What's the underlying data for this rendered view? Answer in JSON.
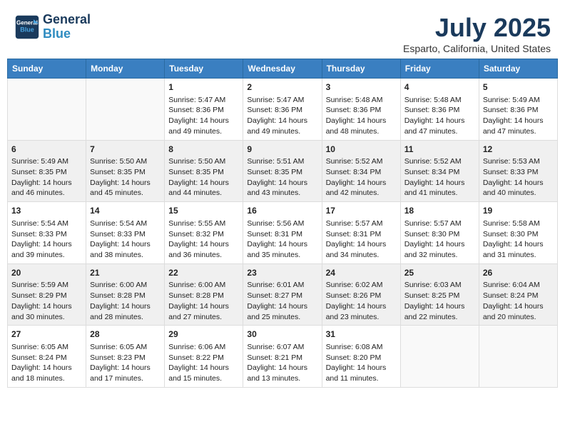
{
  "header": {
    "logo_line1": "General",
    "logo_line2": "Blue",
    "title": "July 2025",
    "subtitle": "Esparto, California, United States"
  },
  "days_of_week": [
    "Sunday",
    "Monday",
    "Tuesday",
    "Wednesday",
    "Thursday",
    "Friday",
    "Saturday"
  ],
  "weeks": [
    [
      {
        "num": "",
        "info": ""
      },
      {
        "num": "",
        "info": ""
      },
      {
        "num": "1",
        "info": "Sunrise: 5:47 AM\nSunset: 8:36 PM\nDaylight: 14 hours and 49 minutes."
      },
      {
        "num": "2",
        "info": "Sunrise: 5:47 AM\nSunset: 8:36 PM\nDaylight: 14 hours and 49 minutes."
      },
      {
        "num": "3",
        "info": "Sunrise: 5:48 AM\nSunset: 8:36 PM\nDaylight: 14 hours and 48 minutes."
      },
      {
        "num": "4",
        "info": "Sunrise: 5:48 AM\nSunset: 8:36 PM\nDaylight: 14 hours and 47 minutes."
      },
      {
        "num": "5",
        "info": "Sunrise: 5:49 AM\nSunset: 8:36 PM\nDaylight: 14 hours and 47 minutes."
      }
    ],
    [
      {
        "num": "6",
        "info": "Sunrise: 5:49 AM\nSunset: 8:35 PM\nDaylight: 14 hours and 46 minutes."
      },
      {
        "num": "7",
        "info": "Sunrise: 5:50 AM\nSunset: 8:35 PM\nDaylight: 14 hours and 45 minutes."
      },
      {
        "num": "8",
        "info": "Sunrise: 5:50 AM\nSunset: 8:35 PM\nDaylight: 14 hours and 44 minutes."
      },
      {
        "num": "9",
        "info": "Sunrise: 5:51 AM\nSunset: 8:35 PM\nDaylight: 14 hours and 43 minutes."
      },
      {
        "num": "10",
        "info": "Sunrise: 5:52 AM\nSunset: 8:34 PM\nDaylight: 14 hours and 42 minutes."
      },
      {
        "num": "11",
        "info": "Sunrise: 5:52 AM\nSunset: 8:34 PM\nDaylight: 14 hours and 41 minutes."
      },
      {
        "num": "12",
        "info": "Sunrise: 5:53 AM\nSunset: 8:33 PM\nDaylight: 14 hours and 40 minutes."
      }
    ],
    [
      {
        "num": "13",
        "info": "Sunrise: 5:54 AM\nSunset: 8:33 PM\nDaylight: 14 hours and 39 minutes."
      },
      {
        "num": "14",
        "info": "Sunrise: 5:54 AM\nSunset: 8:33 PM\nDaylight: 14 hours and 38 minutes."
      },
      {
        "num": "15",
        "info": "Sunrise: 5:55 AM\nSunset: 8:32 PM\nDaylight: 14 hours and 36 minutes."
      },
      {
        "num": "16",
        "info": "Sunrise: 5:56 AM\nSunset: 8:31 PM\nDaylight: 14 hours and 35 minutes."
      },
      {
        "num": "17",
        "info": "Sunrise: 5:57 AM\nSunset: 8:31 PM\nDaylight: 14 hours and 34 minutes."
      },
      {
        "num": "18",
        "info": "Sunrise: 5:57 AM\nSunset: 8:30 PM\nDaylight: 14 hours and 32 minutes."
      },
      {
        "num": "19",
        "info": "Sunrise: 5:58 AM\nSunset: 8:30 PM\nDaylight: 14 hours and 31 minutes."
      }
    ],
    [
      {
        "num": "20",
        "info": "Sunrise: 5:59 AM\nSunset: 8:29 PM\nDaylight: 14 hours and 30 minutes."
      },
      {
        "num": "21",
        "info": "Sunrise: 6:00 AM\nSunset: 8:28 PM\nDaylight: 14 hours and 28 minutes."
      },
      {
        "num": "22",
        "info": "Sunrise: 6:00 AM\nSunset: 8:28 PM\nDaylight: 14 hours and 27 minutes."
      },
      {
        "num": "23",
        "info": "Sunrise: 6:01 AM\nSunset: 8:27 PM\nDaylight: 14 hours and 25 minutes."
      },
      {
        "num": "24",
        "info": "Sunrise: 6:02 AM\nSunset: 8:26 PM\nDaylight: 14 hours and 23 minutes."
      },
      {
        "num": "25",
        "info": "Sunrise: 6:03 AM\nSunset: 8:25 PM\nDaylight: 14 hours and 22 minutes."
      },
      {
        "num": "26",
        "info": "Sunrise: 6:04 AM\nSunset: 8:24 PM\nDaylight: 14 hours and 20 minutes."
      }
    ],
    [
      {
        "num": "27",
        "info": "Sunrise: 6:05 AM\nSunset: 8:24 PM\nDaylight: 14 hours and 18 minutes."
      },
      {
        "num": "28",
        "info": "Sunrise: 6:05 AM\nSunset: 8:23 PM\nDaylight: 14 hours and 17 minutes."
      },
      {
        "num": "29",
        "info": "Sunrise: 6:06 AM\nSunset: 8:22 PM\nDaylight: 14 hours and 15 minutes."
      },
      {
        "num": "30",
        "info": "Sunrise: 6:07 AM\nSunset: 8:21 PM\nDaylight: 14 hours and 13 minutes."
      },
      {
        "num": "31",
        "info": "Sunrise: 6:08 AM\nSunset: 8:20 PM\nDaylight: 14 hours and 11 minutes."
      },
      {
        "num": "",
        "info": ""
      },
      {
        "num": "",
        "info": ""
      }
    ]
  ]
}
